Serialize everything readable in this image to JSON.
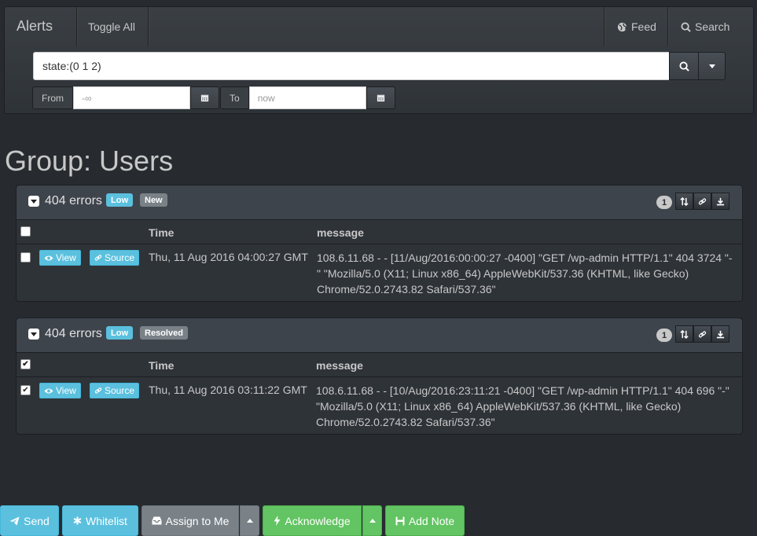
{
  "navbar": {
    "brand": "Alerts",
    "toggle_all": "Toggle All",
    "feed": "Feed",
    "search": "Search"
  },
  "query": {
    "value": "state:(0 1 2)"
  },
  "date_range": {
    "from_label": "From",
    "from_placeholder": "-∞",
    "to_label": "To",
    "to_placeholder": "now"
  },
  "group_title": "Group: Users",
  "panels": [
    {
      "title": "404 errors",
      "severity": "Low",
      "status": "New",
      "count": "1",
      "header_checked": false,
      "columns": {
        "time": "Time",
        "message": "message"
      },
      "row": {
        "checked": false,
        "view_label": "View",
        "source_label": "Source",
        "time": "Thu, 11 Aug 2016 04:00:27 GMT",
        "message": "108.6.11.68 - - [11/Aug/2016:00:00:27 -0400] \"GET /wp-admin HTTP/1.1\" 404 3724 \"-\" \"Mozilla/5.0 (X11; Linux x86_64) AppleWebKit/537.36 (KHTML, like Gecko) Chrome/52.0.2743.82 Safari/537.36\""
      }
    },
    {
      "title": "404 errors",
      "severity": "Low",
      "status": "Resolved",
      "count": "1",
      "header_checked": true,
      "columns": {
        "time": "Time",
        "message": "message"
      },
      "row": {
        "checked": true,
        "view_label": "View",
        "source_label": "Source",
        "time": "Thu, 11 Aug 2016 03:11:22 GMT",
        "message": "108.6.11.68 - - [10/Aug/2016:23:11:21 -0400] \"GET /wp-admin HTTP/1.1\" 404 696 \"-\" \"Mozilla/5.0 (X11; Linux x86_64) AppleWebKit/537.36 (KHTML, like Gecko) Chrome/52.0.2743.82 Safari/537.36\""
      }
    }
  ],
  "toolbar": {
    "send": "Send",
    "whitelist": "Whitelist",
    "assign": "Assign to Me",
    "acknowledge": "Acknowledge",
    "add_note": "Add Note"
  },
  "colors": {
    "background": "#272b30",
    "info": "#5bc0de",
    "success": "#62c462",
    "default": "#7a8288"
  }
}
